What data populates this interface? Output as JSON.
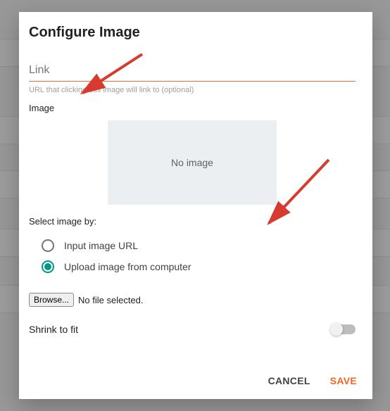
{
  "dialog": {
    "title": "Configure Image",
    "link": {
      "placeholder": "Link",
      "helper": "URL that clicking this image will link to (optional)"
    },
    "image_label": "Image",
    "preview_text": "No image",
    "select_by_label": "Select image by:",
    "radio_url": "Input image URL",
    "radio_upload": "Upload image from computer",
    "browse": "Browse...",
    "no_file": "No file selected.",
    "shrink_label": "Shrink to fit",
    "cancel": "CANCEL",
    "save": "SAVE"
  }
}
